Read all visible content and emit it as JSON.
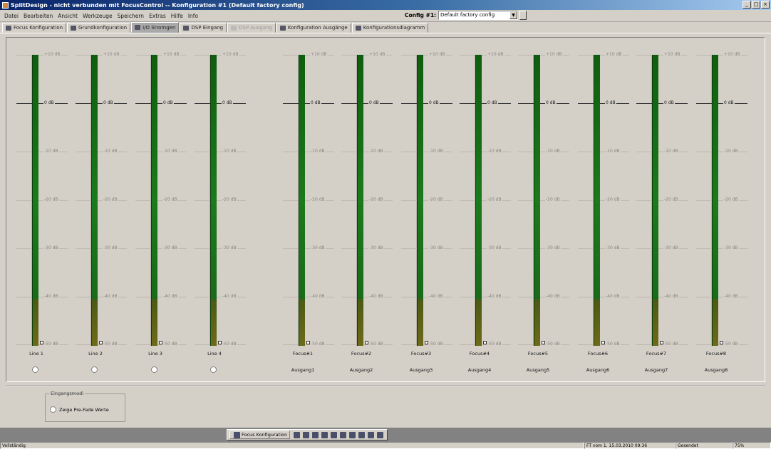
{
  "window": {
    "title": "SplitDesign - nicht verbunden mit FocusControl -- Konfiguration #1 (Default factory config)",
    "buttons": [
      "_",
      "□",
      "×"
    ]
  },
  "menu": {
    "items": [
      "Datei",
      "Bearbeiten",
      "Ansicht",
      "Werkzeuge",
      "Speichern",
      "Extras",
      "Hilfe",
      "Info"
    ],
    "config_label": "Config #1:",
    "config_value": "Default factory config"
  },
  "tabs": [
    {
      "label": "Focus Konfiguration",
      "icon": "eye-icon",
      "state": "normal"
    },
    {
      "label": "Grundkonfiguration",
      "icon": "cursor-icon",
      "state": "normal"
    },
    {
      "label": "I/O Stromgen",
      "icon": "meter-icon",
      "state": "active"
    },
    {
      "label": "DSP Eingang",
      "icon": "dsp-icon",
      "state": "normal"
    },
    {
      "label": "DSP Ausgang",
      "icon": "dsp-icon",
      "state": "disabled"
    },
    {
      "label": "Konfiguration Ausgänge",
      "icon": "output-icon",
      "state": "normal"
    },
    {
      "label": "Konfigurationsdiagramm",
      "icon": "diagram-icon",
      "state": "normal"
    }
  ],
  "meter_scale": [
    "+10 dB",
    "0 dB",
    "-10 dB",
    "-20 dB",
    "-30 dB",
    "-40 dB",
    "-50 dB"
  ],
  "inputs": [
    {
      "name": "Line 1"
    },
    {
      "name": "Line 2"
    },
    {
      "name": "Line 3"
    },
    {
      "name": "Line 4"
    }
  ],
  "outputs": [
    {
      "name": "Focus#1",
      "sub": "Ausgang1"
    },
    {
      "name": "Focus#2",
      "sub": "Ausgang2"
    },
    {
      "name": "Focus#3",
      "sub": "Ausgang3"
    },
    {
      "name": "Focus#4",
      "sub": "Ausgang4"
    },
    {
      "name": "Focus#5",
      "sub": "Ausgang5"
    },
    {
      "name": "Focus#6",
      "sub": "Ausgang6"
    },
    {
      "name": "Focus#7",
      "sub": "Ausgang7"
    },
    {
      "name": "Focus#8",
      "sub": "Ausgang8"
    }
  ],
  "meter_level_fraction": 1.0,
  "groupbox": {
    "legend": "Eingangsmodi",
    "option": "Zeige Pre-Fade Werte"
  },
  "bottom_toolbar": {
    "main_button": "Focus Konfiguration",
    "icons": [
      "cursor-icon",
      "meter-icon",
      "dsp-icon",
      "dsp-out-icon",
      "output-icon",
      "diagram-icon",
      "chart-icon",
      "tools-icon",
      "camera-icon",
      "help-icon"
    ]
  },
  "status": {
    "left": "Vollständig",
    "date": "FT vom 1. 15.03.2010 09:36",
    "state": "Gesendet",
    "zoom": "75%"
  },
  "colors": {
    "meter_green": "#1b7a1b",
    "meter_low": "#6e6a18",
    "titlebar": "#0a246a"
  }
}
